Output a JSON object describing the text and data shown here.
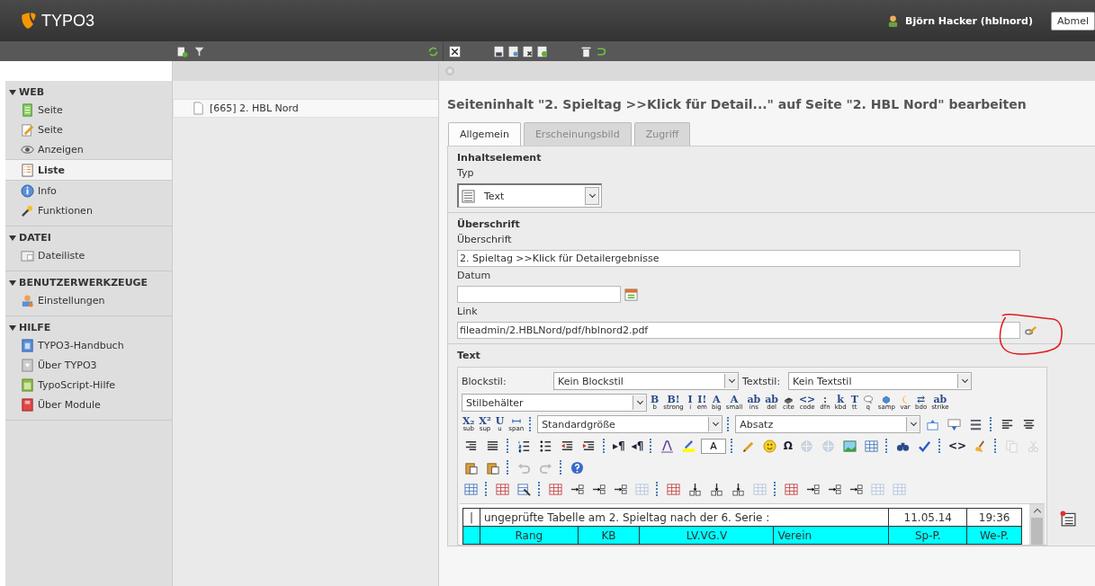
{
  "topbar": {
    "logo": "TYPO3",
    "user": "Björn Hacker (hblnord)",
    "logout": "Abmel"
  },
  "modules": [
    {
      "title": "WEB",
      "expanded": true,
      "items": [
        {
          "label": "Seite",
          "selected": false
        },
        {
          "label": "Seite",
          "selected": false
        },
        {
          "label": "Anzeigen",
          "selected": false
        },
        {
          "label": "Liste",
          "selected": true
        },
        {
          "label": "Info",
          "selected": false
        },
        {
          "label": "Funktionen",
          "selected": false
        }
      ]
    },
    {
      "title": "DATEI",
      "expanded": true,
      "items": [
        {
          "label": "Dateiliste",
          "selected": false
        }
      ]
    },
    {
      "title": "BENUTZERWERKZEUGE",
      "expanded": true,
      "items": [
        {
          "label": "Einstellungen",
          "selected": false
        }
      ]
    },
    {
      "title": "HILFE",
      "expanded": true,
      "items": [
        {
          "label": "TYPO3-Handbuch",
          "selected": false
        },
        {
          "label": "Über TYPO3",
          "selected": false
        },
        {
          "label": "TypoScript-Hilfe",
          "selected": false
        },
        {
          "label": "Über Module",
          "selected": false
        }
      ]
    }
  ],
  "page_tree": {
    "items": [
      {
        "label": "[665] 2. HBL Nord"
      }
    ]
  },
  "form": {
    "heading": "Seiteninhalt \"2. Spieltag >>Klick für Detail...\" auf Seite \"2. HBL Nord\" bearbeiten",
    "tabs": [
      {
        "label": "Allgemein",
        "selected": true
      },
      {
        "label": "Erscheinungsbild",
        "selected": false
      },
      {
        "label": "Zugriff",
        "selected": false
      }
    ],
    "section_1": {
      "title": "Inhaltselement",
      "type_label": "Typ",
      "type_value": "Text"
    },
    "section_2": {
      "title": "Überschrift",
      "header_label": "Überschrift",
      "header_value": "2. Spieltag >>Klick für Detailergebnisse",
      "date_label": "Datum",
      "link_label": "Link",
      "link_value": "fileadmin/2.HBLNord/pdf/hblnord2.pdf"
    },
    "section_3": {
      "title": "Text"
    }
  },
  "rte": {
    "blockstyle_label": "Blockstil:",
    "blockstyle_value": "Kein Blockstil",
    "textstyle_label": "Textstil:",
    "textstyle_value": "Kein Textstil",
    "rows": [
      {
        "items": [
          {
            "kind": "select",
            "value": "Stilbehälter"
          },
          {
            "kind": "tag",
            "glyph": "B",
            "label": "b"
          },
          {
            "kind": "tag",
            "glyph": "B!",
            "label": "strong"
          },
          {
            "kind": "tag",
            "glyph": "I",
            "label": "i"
          },
          {
            "kind": "tag",
            "glyph": "I!",
            "label": "em"
          },
          {
            "kind": "tag",
            "glyph": "A",
            "label": "big"
          },
          {
            "kind": "tag",
            "glyph": "A",
            "label": "small"
          },
          {
            "kind": "tag",
            "glyph": "ab",
            "label": "ins"
          },
          {
            "kind": "tag",
            "glyph": "ab",
            "label": "del"
          },
          {
            "kind": "tag",
            "label": "cite"
          },
          {
            "kind": "tag",
            "glyph": "<>",
            "label": "code"
          },
          {
            "kind": "tag",
            "glyph": ":",
            "label": "dfn"
          },
          {
            "kind": "tag",
            "glyph": "k",
            "label": "kbd"
          },
          {
            "kind": "tag",
            "glyph": "T",
            "label": "tt"
          },
          {
            "kind": "tag",
            "label": "q"
          },
          {
            "kind": "tag",
            "label": "samp"
          },
          {
            "kind": "tag",
            "label": "var"
          },
          {
            "kind": "tag",
            "glyph": "⇄",
            "label": "bdo"
          },
          {
            "kind": "tag",
            "glyph": "ab",
            "label": "strike"
          }
        ]
      },
      {
        "items": [
          {
            "kind": "tag",
            "glyph": "X₂",
            "label": "sub"
          },
          {
            "kind": "tag",
            "glyph": "X²",
            "label": "sup"
          },
          {
            "kind": "tag",
            "glyph": "U",
            "label": "u"
          },
          {
            "kind": "tag",
            "label": "span"
          },
          {
            "kind": "sep"
          },
          {
            "kind": "select",
            "value": "Standardgröße"
          },
          {
            "kind": "sep"
          },
          {
            "kind": "select",
            "value": "Absatz"
          },
          {
            "kind": "icon",
            "disabled": false
          },
          {
            "kind": "icon",
            "disabled": false
          },
          {
            "kind": "icon",
            "disabled": false
          },
          {
            "kind": "sep"
          },
          {
            "kind": "icon",
            "disabled": false
          },
          {
            "kind": "icon",
            "disabled": false
          }
        ]
      },
      {
        "items": [
          {
            "kind": "icon",
            "disabled": false
          },
          {
            "kind": "icon",
            "disabled": false
          },
          {
            "kind": "sep"
          },
          {
            "kind": "icon",
            "disabled": false
          },
          {
            "kind": "icon",
            "disabled": false
          },
          {
            "kind": "icon",
            "disabled": false
          },
          {
            "kind": "icon",
            "disabled": false
          },
          {
            "kind": "sep"
          },
          {
            "kind": "glyph",
            "text": "▸¶"
          },
          {
            "kind": "glyph",
            "text": "◂¶"
          },
          {
            "kind": "sep"
          },
          {
            "kind": "icon",
            "disabled": false
          },
          {
            "kind": "icon",
            "disabled": false
          },
          {
            "kind": "box",
            "text": "A"
          },
          {
            "kind": "sep"
          },
          {
            "kind": "icon",
            "disabled": false
          },
          {
            "kind": "icon",
            "disabled": false
          },
          {
            "kind": "glyph",
            "text": "Ω"
          },
          {
            "kind": "icon",
            "disabled": true
          },
          {
            "kind": "icon",
            "disabled": true
          },
          {
            "kind": "icon",
            "disabled": false
          },
          {
            "kind": "icon",
            "disabled": false
          },
          {
            "kind": "sep"
          },
          {
            "kind": "icon",
            "disabled": false
          },
          {
            "kind": "icon",
            "disabled": false
          },
          {
            "kind": "sep"
          },
          {
            "kind": "glyph",
            "text": "<>"
          },
          {
            "kind": "icon",
            "disabled": false
          },
          {
            "kind": "sep"
          },
          {
            "kind": "icon",
            "disabled": true
          },
          {
            "kind": "icon",
            "disabled": true
          }
        ]
      },
      {
        "items": [
          {
            "kind": "icon",
            "disabled": false
          },
          {
            "kind": "icon",
            "disabled": false
          },
          {
            "kind": "sep"
          },
          {
            "kind": "icon",
            "disabled": true
          },
          {
            "kind": "icon",
            "disabled": true
          },
          {
            "kind": "sep"
          },
          {
            "kind": "icon",
            "disabled": false
          }
        ]
      },
      {
        "items": [
          {
            "kind": "icon",
            "disabled": false
          },
          {
            "kind": "sep"
          },
          {
            "kind": "icon",
            "disabled": false
          },
          {
            "kind": "icon",
            "disabled": false
          },
          {
            "kind": "sep"
          },
          {
            "kind": "icon",
            "disabled": false
          },
          {
            "kind": "icon",
            "disabled": false
          },
          {
            "kind": "icon",
            "disabled": false
          },
          {
            "kind": "icon",
            "disabled": false
          },
          {
            "kind": "icon",
            "disabled": true
          },
          {
            "kind": "sep"
          },
          {
            "kind": "icon",
            "disabled": false
          },
          {
            "kind": "icon",
            "disabled": false
          },
          {
            "kind": "icon",
            "disabled": false
          },
          {
            "kind": "icon",
            "disabled": false
          },
          {
            "kind": "icon",
            "disabled": true
          },
          {
            "kind": "sep"
          },
          {
            "kind": "icon",
            "disabled": false
          },
          {
            "kind": "icon",
            "disabled": false
          },
          {
            "kind": "icon",
            "disabled": false
          },
          {
            "kind": "icon",
            "disabled": false
          },
          {
            "kind": "icon",
            "disabled": true
          },
          {
            "kind": "icon",
            "disabled": true
          }
        ]
      }
    ],
    "table": {
      "rows": [
        {
          "color": "#ffffff",
          "cells": [
            {
              "text": "|"
            },
            {
              "text": "ungeprüfte Tabelle am 2. Spieltag nach der 6. Serie :",
              "colspan": 4
            },
            {
              "text": "11.05.14"
            },
            {
              "text": "19:36"
            }
          ]
        },
        {
          "color": "#00ffff",
          "cells": [
            {
              "text": ""
            },
            {
              "text": "Rang"
            },
            {
              "text": "KB"
            },
            {
              "text": "LV.VG.V"
            },
            {
              "text": "Verein"
            },
            {
              "text": "Sp-P."
            },
            {
              "text": "We-P."
            }
          ]
        }
      ]
    }
  }
}
